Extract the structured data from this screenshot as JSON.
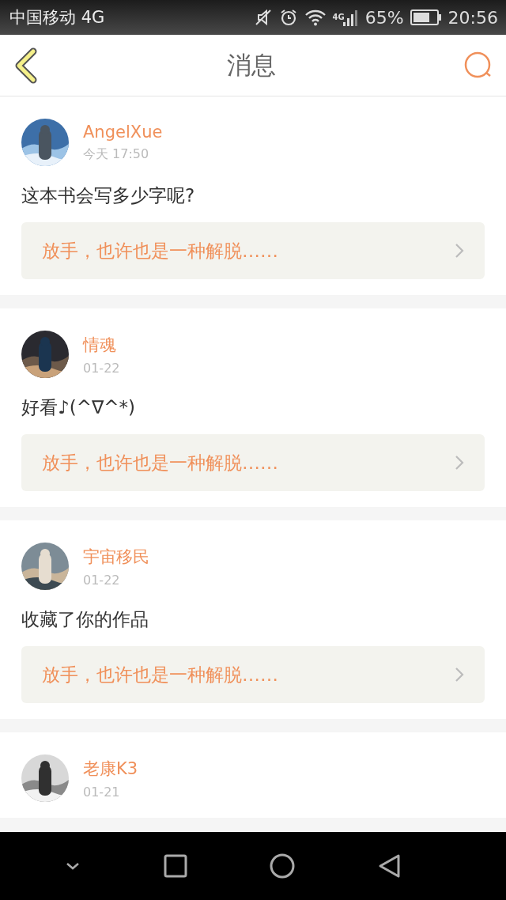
{
  "status_bar": {
    "carrier": "中国移动 4G",
    "network_label": "4G",
    "battery": "65%",
    "time": "20:56"
  },
  "header": {
    "title": "消息"
  },
  "messages": [
    {
      "user": "AngelXue",
      "time": "今天 17:50",
      "text": "这本书会写多少字呢?",
      "quote": "放手，也许也是一种解脱……"
    },
    {
      "user": "情魂",
      "time": "01-22",
      "text": "好看♪(^∇^*)",
      "quote": "放手，也许也是一种解脱……"
    },
    {
      "user": "宇宙移民",
      "time": "01-22",
      "text": "收藏了你的作品",
      "quote": "放手，也许也是一种解脱……"
    },
    {
      "user": "老康K3",
      "time": "01-21"
    }
  ]
}
